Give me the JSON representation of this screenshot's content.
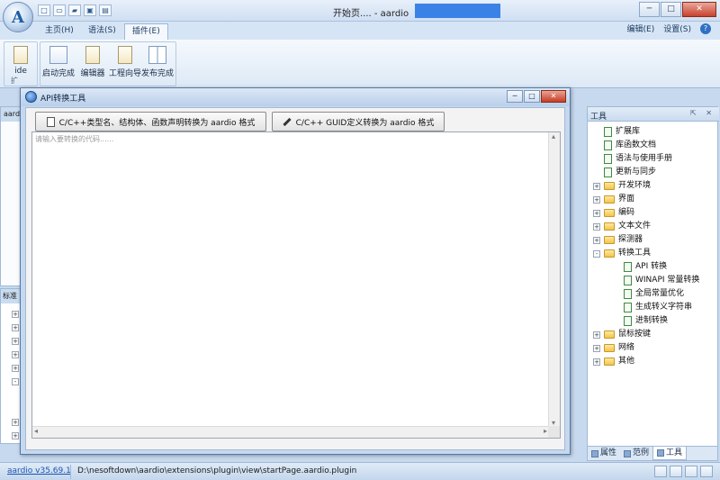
{
  "window": {
    "title": "开始页.... - aardio",
    "controls": {
      "minimize": "─",
      "maximize": "□",
      "close": "✕"
    },
    "orb_glyph": "A"
  },
  "ribbon": {
    "tabs": [
      {
        "label": "主页(H)",
        "active": false
      },
      {
        "label": "语法(S)",
        "active": false
      },
      {
        "label": "插件(E)",
        "active": true
      }
    ],
    "right_menu": {
      "edit": "编辑(E)",
      "settings": "设置(S)",
      "help_glyph": "?"
    },
    "group1": {
      "ide_label": "ide",
      "group_label": "扩"
    },
    "buttons": [
      {
        "label": "启动完成"
      },
      {
        "label": "编辑器"
      },
      {
        "label": "工程向导"
      },
      {
        "label": "发布完成"
      }
    ]
  },
  "left_panes": {
    "top_header": "aard",
    "bottom_header": "标准"
  },
  "dialog": {
    "title": "API转换工具",
    "buttons": {
      "convert_types": "C/C++类型名、结构体、函数声明转换为  aardio 格式",
      "convert_guid": "C/C++ GUID定义转换为  aardio 格式"
    },
    "code_placeholder": "请输入要转换的代码......"
  },
  "tools": {
    "title": "工具",
    "head_icons": "⇱ ✕",
    "tree": [
      {
        "label": "扩展库",
        "type": "doc",
        "level": 1
      },
      {
        "label": "库函数文档",
        "type": "doc",
        "level": 1
      },
      {
        "label": "语法与使用手册",
        "type": "doc",
        "level": 1
      },
      {
        "label": "更新与同步",
        "type": "doc",
        "level": 1
      },
      {
        "label": "开发环境",
        "type": "folder",
        "level": 1,
        "expander": "+"
      },
      {
        "label": "界面",
        "type": "folder",
        "level": 1,
        "expander": "+"
      },
      {
        "label": "编码",
        "type": "folder",
        "level": 1,
        "expander": "+"
      },
      {
        "label": "文本文件",
        "type": "folder",
        "level": 1,
        "expander": "+"
      },
      {
        "label": "探测器",
        "type": "folder",
        "level": 1,
        "expander": "+"
      },
      {
        "label": "转换工具",
        "type": "folder",
        "level": 1,
        "expander": "-"
      },
      {
        "label": "API 转换",
        "type": "doc",
        "level": 2
      },
      {
        "label": "WINAPI 常量转换",
        "type": "doc",
        "level": 2
      },
      {
        "label": "全局常量优化",
        "type": "doc",
        "level": 2
      },
      {
        "label": "生成转义字符串",
        "type": "doc",
        "level": 2
      },
      {
        "label": "进制转换",
        "type": "doc",
        "level": 2
      },
      {
        "label": "鼠标按键",
        "type": "folder",
        "level": 1,
        "expander": "+"
      },
      {
        "label": "网络",
        "type": "folder",
        "level": 1,
        "expander": "+"
      },
      {
        "label": "其他",
        "type": "folder",
        "level": 1,
        "expander": "+"
      }
    ],
    "tabs": [
      {
        "label": "属性",
        "active": false
      },
      {
        "label": "范例",
        "active": false
      },
      {
        "label": "工具",
        "active": true
      }
    ]
  },
  "statusbar": {
    "version": "aardio v35.69.1",
    "path": "D:\\nesoftdown\\aardio\\extensions\\plugin\\view\\startPage.aardio.plugin"
  },
  "colors": {
    "accent": "#3b82e6",
    "frame": "#c7d9ee",
    "folder": "#f3c44a",
    "doc_icon": "#3e8a3e"
  }
}
